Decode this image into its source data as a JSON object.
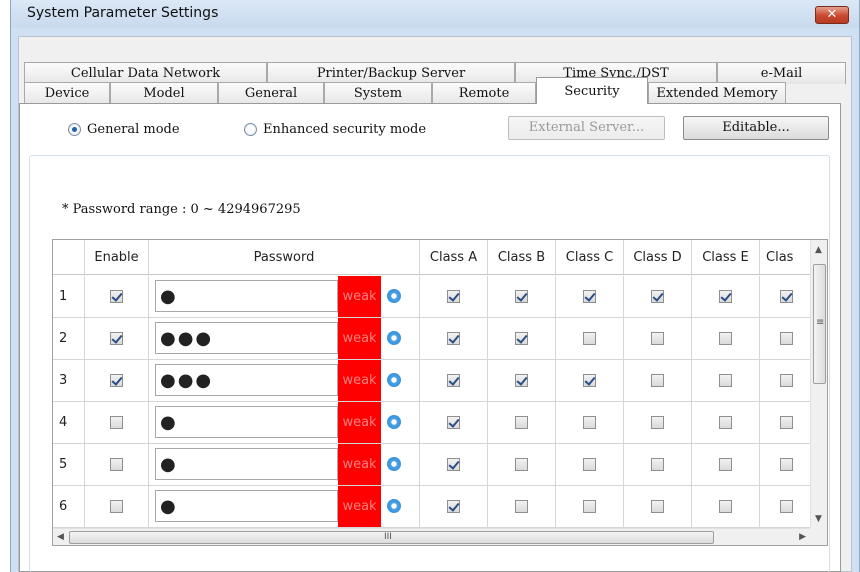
{
  "window": {
    "title": "System Parameter Settings",
    "close_glyph": "✕"
  },
  "tabs": {
    "row1": [
      "Cellular Data Network",
      "Printer/Backup Server",
      "Time Sync./DST",
      "e-Mail"
    ],
    "row2": [
      "Device",
      "Model",
      "General",
      "System",
      "Remote",
      "Security",
      "Extended Memory"
    ],
    "active": "Security"
  },
  "mode": {
    "general_label": "General mode",
    "enhanced_label": "Enhanced security mode",
    "selected": "general"
  },
  "buttons": {
    "external_server": "External Server...",
    "editable": "Editable..."
  },
  "note": "* Password range : 0 ~ 4294967295",
  "grid": {
    "columns": [
      "",
      "Enable",
      "Password",
      "Class A",
      "Class B",
      "Class C",
      "Class D",
      "Class E",
      "Clas"
    ],
    "strength_label": "weak",
    "rows": [
      {
        "num": "1",
        "enable": true,
        "password": "●",
        "classes": [
          true,
          true,
          true,
          true,
          true,
          true
        ]
      },
      {
        "num": "2",
        "enable": true,
        "password": "●●●",
        "classes": [
          true,
          true,
          false,
          false,
          false,
          false
        ]
      },
      {
        "num": "3",
        "enable": true,
        "password": "●●●",
        "classes": [
          true,
          true,
          true,
          false,
          false,
          false
        ]
      },
      {
        "num": "4",
        "enable": false,
        "password": "●",
        "classes": [
          true,
          false,
          false,
          false,
          false,
          false
        ]
      },
      {
        "num": "5",
        "enable": false,
        "password": "●",
        "classes": [
          true,
          false,
          false,
          false,
          false,
          false
        ]
      },
      {
        "num": "6",
        "enable": false,
        "password": "●",
        "classes": [
          true,
          false,
          false,
          false,
          false,
          false
        ]
      }
    ]
  },
  "scroll_arrows": {
    "up": "▲",
    "down": "▼",
    "left": "◀",
    "right": "▶",
    "grip": "≡",
    "hgrip": "III"
  },
  "colors": {
    "weak_bg": "#ff0000",
    "weak_text": "#ff8080",
    "title_bg": "#cfe0f2"
  }
}
